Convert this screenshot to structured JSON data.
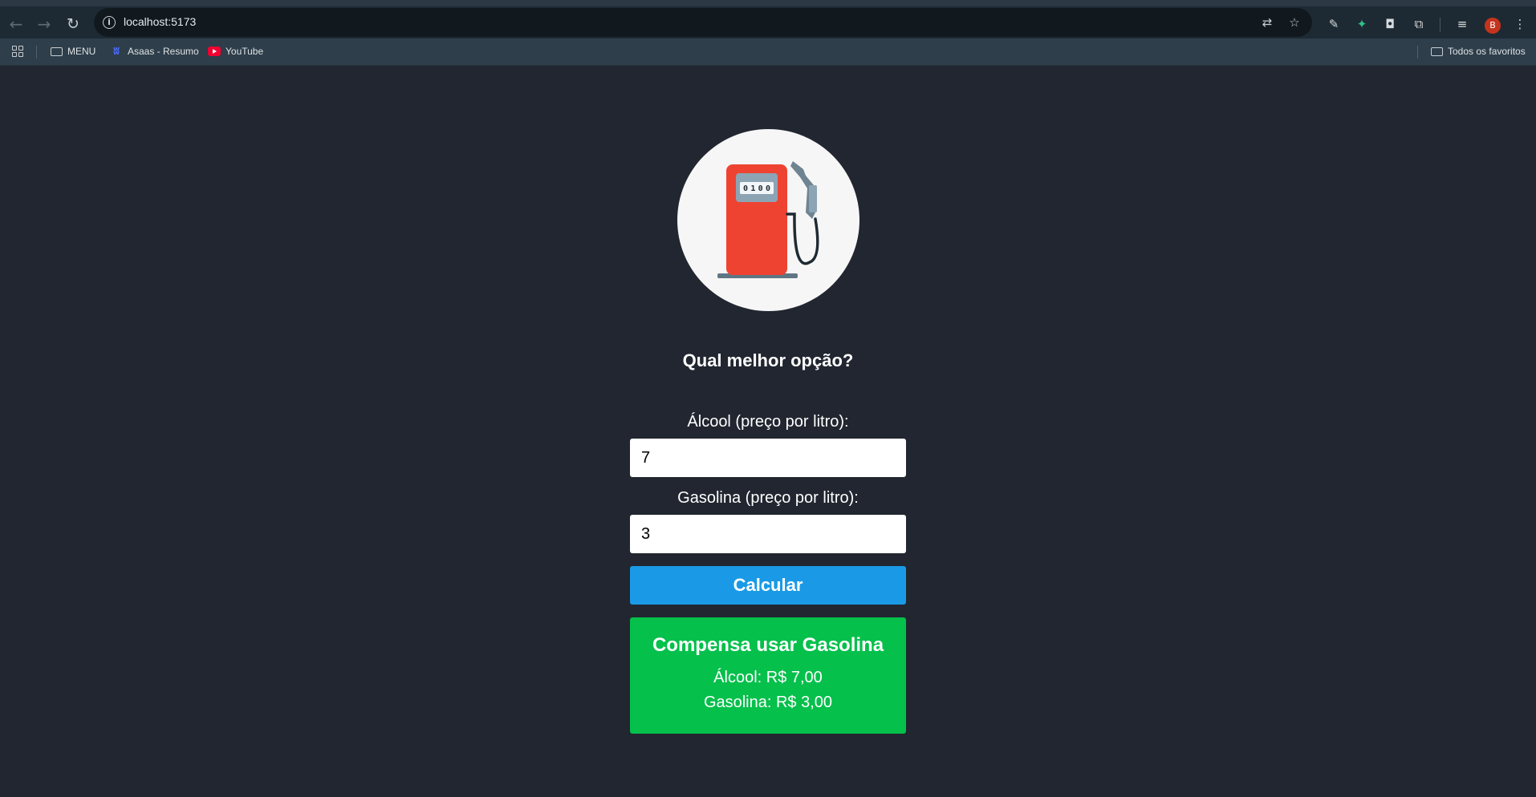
{
  "browser": {
    "url": "localhost:5173",
    "nav_icons": [
      "back-arrow-icon",
      "forward-arrow-icon",
      "reload-icon"
    ],
    "omnibox_icons": [
      "translate-icon",
      "star-icon"
    ],
    "toolbar_icons": [
      "eyedropper-icon",
      "extension-icon",
      "camera-icon",
      "puzzle-icon",
      "reading-list-icon",
      "menu-dots-icon"
    ],
    "profile_initial": "B",
    "profile_color": "#c4341c"
  },
  "bookmarks": {
    "items": [
      {
        "label": "MENU",
        "icon": "folder-icon"
      },
      {
        "label": "Asaas - Resumo",
        "icon": "asaas-logo-icon"
      },
      {
        "label": "YouTube",
        "icon": "youtube-icon"
      }
    ],
    "all_bookmarks": "Todos os favoritos"
  },
  "app": {
    "logo": "gas-pump-icon",
    "pump_counter": "0100",
    "title": "Qual melhor opção?",
    "alcool_label": "Álcool (preço por litro):",
    "alcool_value": "7",
    "gasolina_label": "Gasolina (preço por litro):",
    "gasolina_value": "3",
    "calc_button": "Calcular",
    "result": {
      "title": "Compensa usar Gasolina",
      "alcool_line": "Álcool: R$ 7,00",
      "gasolina_line": "Gasolina: R$ 3,00"
    }
  },
  "colors": {
    "page_bg": "#212630",
    "button": "#1a9ae6",
    "result_bg": "#05c04b"
  }
}
